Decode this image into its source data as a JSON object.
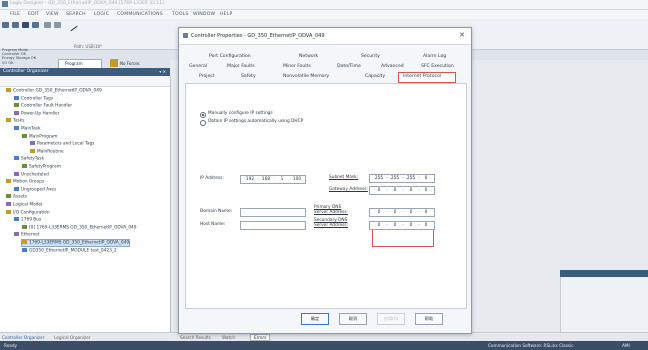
{
  "window": {
    "title": "Logix Designer - GD_350_EthernetIP_ODVA_049 [1769-L33ER 33.11]"
  },
  "menu": [
    "FILE",
    "EDIT",
    "VIEW",
    "SEARCH",
    "LOGIC",
    "COMMUNICATIONS",
    "TOOLS",
    "WINDOW",
    "HELP"
  ],
  "toolbar": {
    "status_lines": [
      "Program Mode",
      "Controller OK",
      "Energy Storage OK",
      "I/O OK"
    ],
    "path_label": "Path: USB\\16*",
    "program_tab": "Program",
    "safety_tab": "Safety",
    "forces_tab": "No Forces"
  },
  "organizer": {
    "header": "Controller Organizer",
    "items": [
      {
        "label": "Controller GD_350_EthernetIP_ODVA_049",
        "indent": 0
      },
      {
        "label": "Controller Tags",
        "indent": 1
      },
      {
        "label": "Controller Fault Handler",
        "indent": 1
      },
      {
        "label": "Power-Up Handler",
        "indent": 1
      },
      {
        "label": "Tasks",
        "indent": 0
      },
      {
        "label": "MainTask",
        "indent": 1
      },
      {
        "label": "MainProgram",
        "indent": 2
      },
      {
        "label": "Parameters and Local Tags",
        "indent": 3
      },
      {
        "label": "MainRoutine",
        "indent": 3
      },
      {
        "label": "SafetyTask",
        "indent": 1
      },
      {
        "label": "SafetyProgram",
        "indent": 2
      },
      {
        "label": "Unscheduled",
        "indent": 1
      },
      {
        "label": "Motion Groups",
        "indent": 0
      },
      {
        "label": "Ungrouped Axes",
        "indent": 1
      },
      {
        "label": "Assets",
        "indent": 0
      },
      {
        "label": "Logical Model",
        "indent": 0
      },
      {
        "label": "I/O Configuration",
        "indent": 0
      },
      {
        "label": "1769 Bus",
        "indent": 1
      },
      {
        "label": "[0] 1769-L33ERMS GD_350_EthernetIP_ODVA_049",
        "indent": 2
      },
      {
        "label": "Ethernet",
        "indent": 1
      },
      {
        "label": "1769-L33ERMS GD_350_EthernetIP_ODVA_049",
        "indent": 2,
        "selected": true
      },
      {
        "label": "GD350_EthernetIP_MODULE test_0423_2",
        "indent": 2
      }
    ]
  },
  "dialog": {
    "title": "Controller Properties - GD_350_EthernetIP_ODVA_049",
    "tabs_row1": [
      "Port Configuration",
      "Network",
      "Security",
      "Alarm Log"
    ],
    "tabs_row2": [
      "General",
      "Major Faults",
      "Minor Faults",
      "Date/Time",
      "Advanced",
      "SFC Execution"
    ],
    "tabs_row3": [
      "Project",
      "Safety",
      "Nonvolatile Memory",
      "Capacity",
      "Internet Protocol"
    ],
    "active_tab": "Internet Protocol",
    "radio_manual": "Manually configure IP settings",
    "radio_dhcp": "Obtain IP settings automatically using DHCP",
    "ip_address_label": "IP Address:",
    "ip_address": [
      "192",
      "168",
      "1",
      "100"
    ],
    "subnet_label": "Subnet Mask:",
    "subnet": [
      "255",
      "255",
      "255",
      "0"
    ],
    "gateway_label": "Gateway Address:",
    "gateway": [
      "0",
      "0",
      "0",
      "0"
    ],
    "domain_label": "Domain Name:",
    "domain_value": "",
    "host_label": "Host Name:",
    "host_value": "",
    "primary_dns_label": "Primary DNS Server Address:",
    "primary_dns": [
      "0",
      "0",
      "0",
      "0"
    ],
    "secondary_dns_label": "Secondary DNS Server Address:",
    "secondary_dns": [
      "0",
      "0",
      "0",
      "0"
    ],
    "buttons": {
      "ok": "确定",
      "cancel": "取消",
      "apply": "应用(A)",
      "help": "帮助"
    }
  },
  "bottom_tabs": {
    "organizer": "Controller Organizer",
    "logical": "Logical Organizer",
    "search": "Search Results",
    "watch": "Watch",
    "errors": "Errors"
  },
  "statusbar": {
    "left": "Ready",
    "right": "Communication Software: RSLinx Classic",
    "lang": "AMI"
  },
  "colors": {
    "accent": "#3d5b7c",
    "highlight_red": "#d9534f",
    "status_bar": "#3b4e66"
  }
}
